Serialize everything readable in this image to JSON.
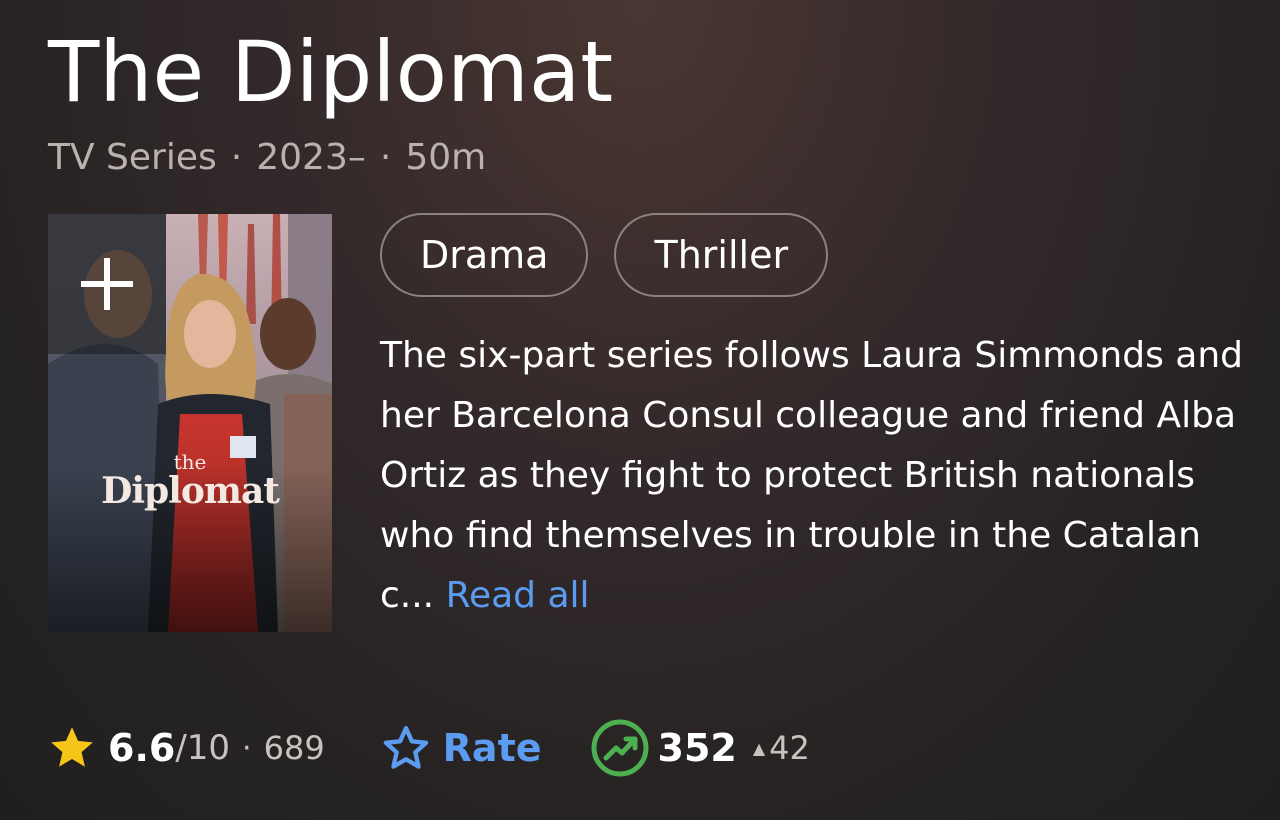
{
  "title": "The Diplomat",
  "meta": {
    "type": "TV Series",
    "years": "2023–",
    "runtime": "50m",
    "separator": "·"
  },
  "poster": {
    "title_small": "the",
    "title_big": "Diplomat",
    "add_icon": "plus-icon"
  },
  "genres": [
    "Drama",
    "Thriller"
  ],
  "plot": {
    "text": "The six-part series follows Laura Simmonds and her Barcelona Consul colleague and friend Alba Ortiz as they fight to protect British nationals who find themselves in trouble in the Catalan c...",
    "read_all": "Read all"
  },
  "rating": {
    "value": "6.6",
    "scale": "/10",
    "separator": "·",
    "count": "689",
    "icon": "star-icon",
    "color": "#f5c518"
  },
  "rate": {
    "label": "Rate",
    "icon": "star-outline-icon",
    "color": "#5b9bf0"
  },
  "popularity": {
    "value": "352",
    "change": "42",
    "icon": "trending-up-icon",
    "color": "#4caf50"
  }
}
